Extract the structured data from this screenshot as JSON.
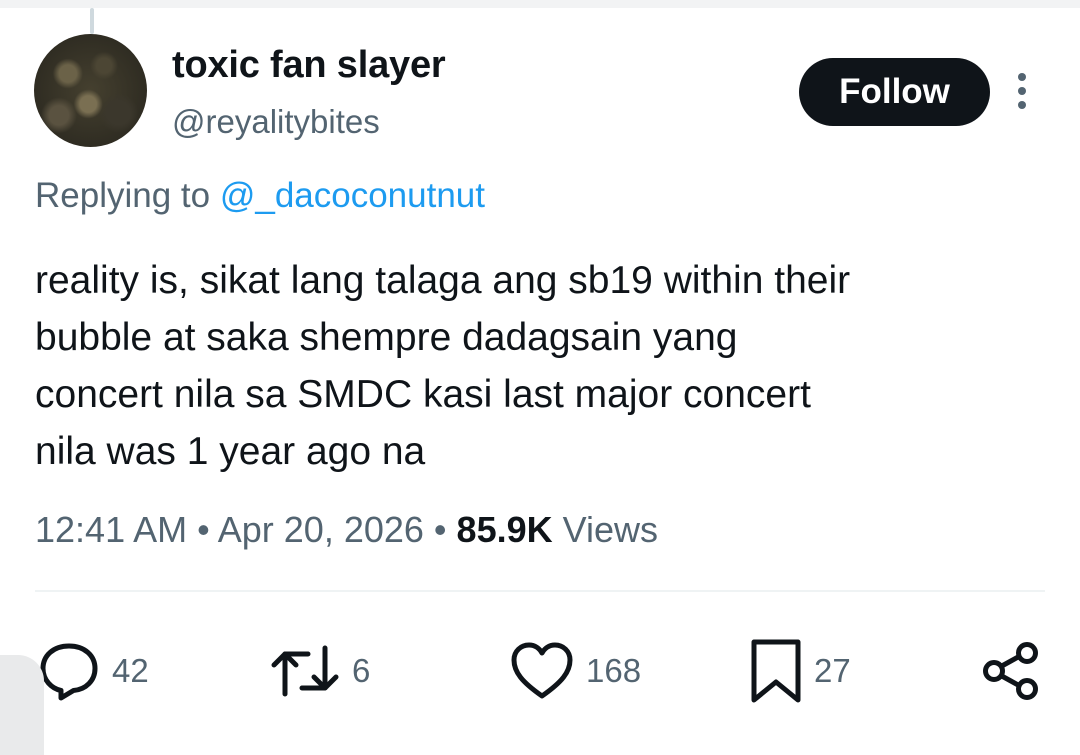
{
  "tweet": {
    "author": {
      "display_name": "toxic fan slayer",
      "handle": "@reyalitybites"
    },
    "follow_label": "Follow",
    "reply_prefix": "Replying to ",
    "reply_to": "@_dacoconutnut",
    "text_lines": [
      "reality is, sikat lang talaga ang sb19 within their",
      "bubble at saka shempre dadagsain yang",
      "concert nila sa SMDC kasi last major concert",
      "nila was 1 year ago na"
    ],
    "time": "12:41 AM",
    "separator": "•",
    "date": "Apr 20, 2026",
    "views_count": "85.9K",
    "views_label": "Views"
  },
  "actions": {
    "reply": {
      "icon": "reply-icon",
      "count": "42"
    },
    "retweet": {
      "icon": "retweet-icon",
      "count": "6"
    },
    "like": {
      "icon": "heart-icon",
      "count": "168"
    },
    "bookmark": {
      "icon": "bookmark-icon",
      "count": "27"
    },
    "share": {
      "icon": "share-icon"
    }
  },
  "colors": {
    "text": "#0f1419",
    "secondary": "#536471",
    "link": "#1d9bf0",
    "follow_bg": "#0f1419",
    "background": "#ffffff"
  }
}
